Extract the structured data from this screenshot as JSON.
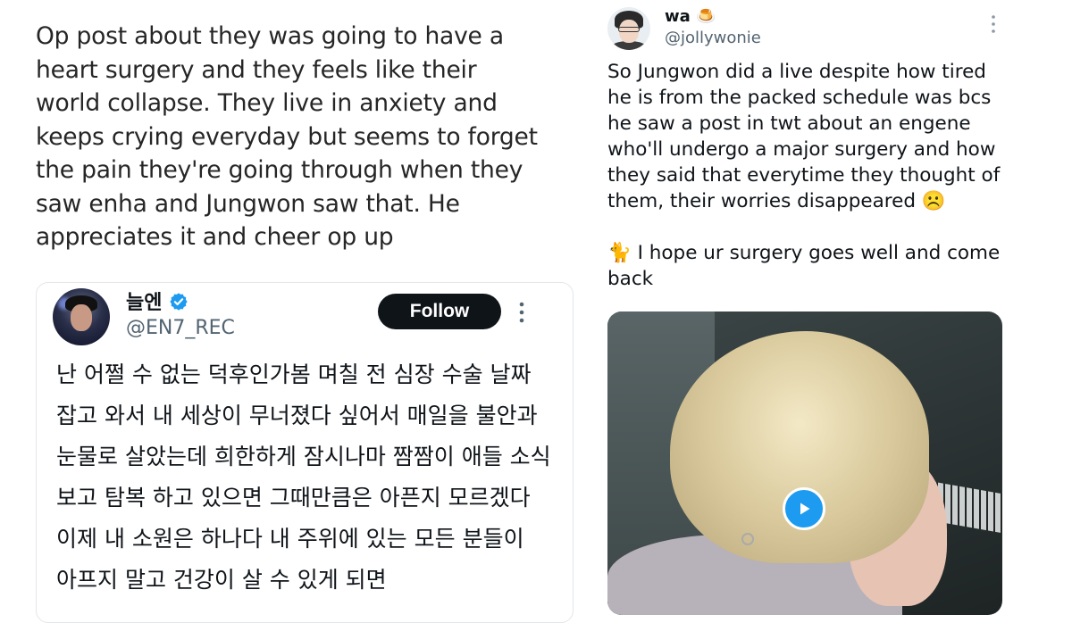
{
  "left": {
    "caption": "Op post about they was going to have a heart surgery and they feels like their world collapse. They live in anxiety and keeps crying everyday but seems to forget the pain they're going through when they saw enha and Jungwon saw that. He appreciates it and cheer op up",
    "embed": {
      "display_name": "늘엔",
      "handle": "@EN7_REC",
      "follow_label": "Follow",
      "text": "난 어쩔 수 없는 덕후인가봄 며칠 전 심장 수술 날짜 잡고 와서 내 세상이 무너졌다 싶어서 매일을 불안과 눈물로 살았는데 희한하게 잠시나마 짬짬이 애들 소식 보고 탐복 하고 있으면 그때만큼은 아픈지 모르겠다 이제 내 소원은 하나다 내 주위에 있는 모든 분들이 아프지 말고 건강이 살 수 있게 되면",
      "verified_icon": "verified-badge-icon",
      "accent_color": "#1d9bf0"
    }
  },
  "right": {
    "display_name": "wa 🍮",
    "handle": "@jollywonie",
    "paragraphs": [
      "So Jungwon did a live despite how tired he is from the packed schedule was bcs he saw a post in twt about an engene who'll undergo a major surgery and how they said that everytime they thought of them, their worries disappeared ☹️",
      "🐈 I hope ur surgery goes well and come back"
    ],
    "media": {
      "type": "video",
      "play_icon": "play-icon"
    }
  }
}
